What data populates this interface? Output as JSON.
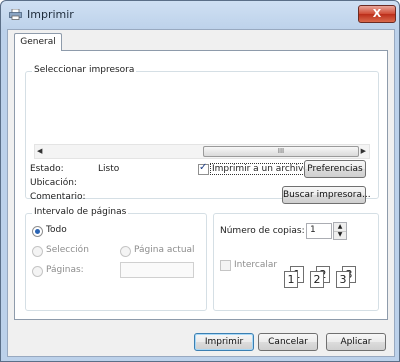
{
  "window": {
    "title": "Imprimir",
    "close_glyph": "X"
  },
  "tabs": [
    {
      "label": "General"
    }
  ],
  "printer_group": {
    "legend": "Seleccionar impresora",
    "scroll_thumb_glyph": "III",
    "status_label": "Estado:",
    "status_value": "Listo",
    "location_label": "Ubicación:",
    "location_value": "",
    "comment_label": "Comentario:",
    "comment_value": "",
    "print_to_file_label": "Imprimir a un archivo",
    "print_to_file_checked": true,
    "preferences_button": "Preferencias",
    "find_printer_button": "Buscar impresora..."
  },
  "range_group": {
    "legend": "Intervalo de páginas",
    "options": [
      {
        "label": "Todo",
        "selected": true,
        "enabled": true
      },
      {
        "label": "Selección",
        "selected": false,
        "enabled": false
      },
      {
        "label": "Página actual",
        "selected": false,
        "enabled": false
      },
      {
        "label": "Páginas:",
        "selected": false,
        "enabled": false
      }
    ],
    "pages_input_value": ""
  },
  "copies_group": {
    "copies_label": "Número de copias:",
    "copies_value": "1",
    "collate_label": "Intercalar",
    "collate_checked": false,
    "collate_enabled": false,
    "collate_pages": [
      "1",
      "1",
      "2",
      "2",
      "3",
      "3"
    ]
  },
  "buttons": {
    "print": "Imprimir",
    "cancel": "Cancelar",
    "apply": "Aplicar"
  },
  "colors": {
    "title_gradient": "#bcd1ea",
    "close_red": "#cf4a34",
    "radio_dot": "#2a64b4"
  }
}
